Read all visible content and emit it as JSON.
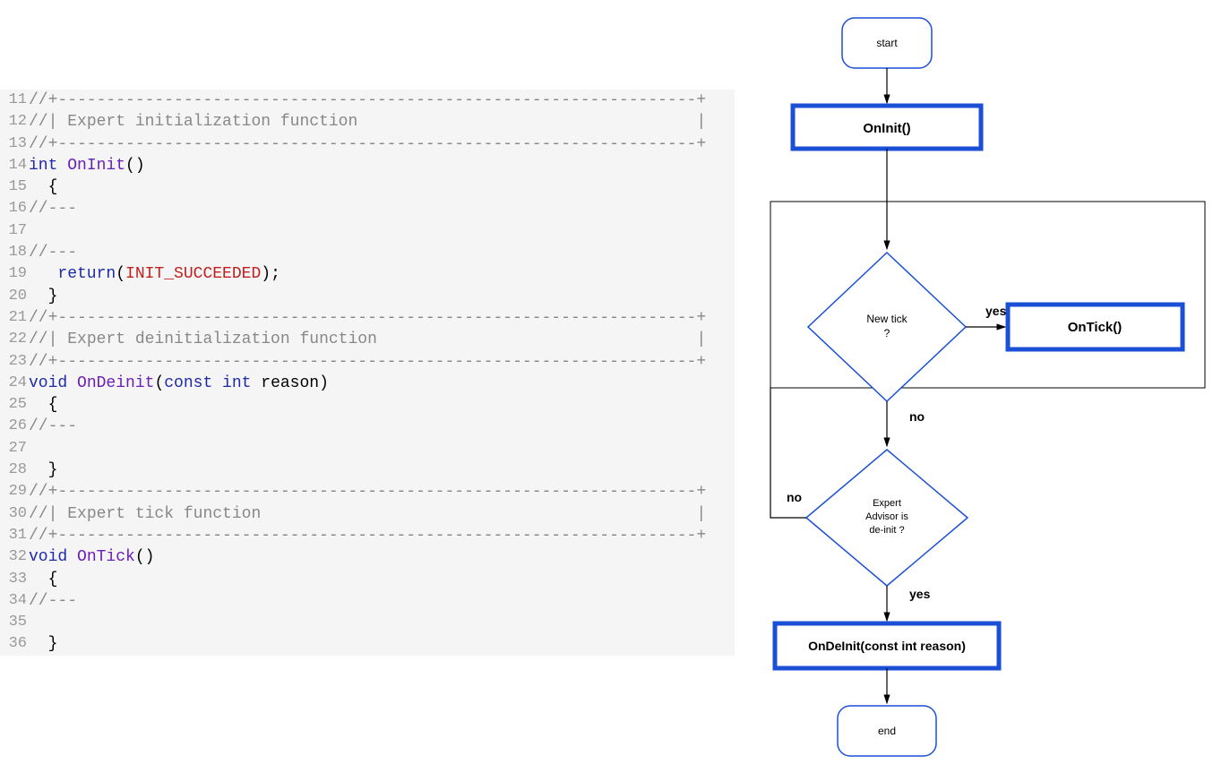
{
  "code": {
    "lines": [
      {
        "num": "11",
        "tokens": [
          {
            "t": "//+",
            "c": "c-gray"
          },
          {
            "t": "------------------------------------------------------------------+",
            "c": "c-gray"
          }
        ]
      },
      {
        "num": "12",
        "tokens": [
          {
            "t": "//| ",
            "c": "c-gray"
          },
          {
            "t": "Expert initialization function",
            "c": "c-gray"
          },
          {
            "t": "                                   |",
            "c": "c-gray"
          }
        ]
      },
      {
        "num": "13",
        "tokens": [
          {
            "t": "//+",
            "c": "c-gray"
          },
          {
            "t": "------------------------------------------------------------------+",
            "c": "c-gray"
          }
        ]
      },
      {
        "num": "14",
        "tokens": [
          {
            "t": "int ",
            "c": "c-kw"
          },
          {
            "t": "OnInit",
            "c": "c-fn"
          },
          {
            "t": "()",
            "c": "c-paren"
          }
        ]
      },
      {
        "num": "15",
        "tokens": [
          {
            "t": "  {",
            "c": "c-id"
          }
        ]
      },
      {
        "num": "16",
        "tokens": [
          {
            "t": "//---",
            "c": "c-gray"
          }
        ]
      },
      {
        "num": "17",
        "tokens": [
          {
            "t": "",
            "c": "c-id"
          }
        ]
      },
      {
        "num": "18",
        "tokens": [
          {
            "t": "//---",
            "c": "c-gray"
          }
        ]
      },
      {
        "num": "19",
        "tokens": [
          {
            "t": "   ",
            "c": "c-id"
          },
          {
            "t": "return",
            "c": "c-kw"
          },
          {
            "t": "(",
            "c": "c-paren"
          },
          {
            "t": "INIT_SUCCEEDED",
            "c": "c-const"
          },
          {
            "t": ");",
            "c": "c-paren"
          }
        ]
      },
      {
        "num": "20",
        "tokens": [
          {
            "t": "  }",
            "c": "c-id"
          }
        ]
      },
      {
        "num": "21",
        "tokens": [
          {
            "t": "//+",
            "c": "c-gray"
          },
          {
            "t": "------------------------------------------------------------------+",
            "c": "c-gray"
          }
        ]
      },
      {
        "num": "22",
        "tokens": [
          {
            "t": "//| ",
            "c": "c-gray"
          },
          {
            "t": "Expert deinitialization function",
            "c": "c-gray"
          },
          {
            "t": "                                 |",
            "c": "c-gray"
          }
        ]
      },
      {
        "num": "23",
        "tokens": [
          {
            "t": "//+",
            "c": "c-gray"
          },
          {
            "t": "------------------------------------------------------------------+",
            "c": "c-gray"
          }
        ]
      },
      {
        "num": "24",
        "tokens": [
          {
            "t": "void ",
            "c": "c-kw"
          },
          {
            "t": "OnDeinit",
            "c": "c-fn"
          },
          {
            "t": "(",
            "c": "c-paren"
          },
          {
            "t": "const int ",
            "c": "c-kw"
          },
          {
            "t": "reason",
            "c": "c-id"
          },
          {
            "t": ")",
            "c": "c-paren"
          }
        ]
      },
      {
        "num": "25",
        "tokens": [
          {
            "t": "  {",
            "c": "c-id"
          }
        ]
      },
      {
        "num": "26",
        "tokens": [
          {
            "t": "//---",
            "c": "c-gray"
          }
        ]
      },
      {
        "num": "27",
        "tokens": [
          {
            "t": "",
            "c": "c-id"
          }
        ]
      },
      {
        "num": "28",
        "tokens": [
          {
            "t": "  }",
            "c": "c-id"
          }
        ]
      },
      {
        "num": "29",
        "tokens": [
          {
            "t": "//+",
            "c": "c-gray"
          },
          {
            "t": "------------------------------------------------------------------+",
            "c": "c-gray"
          }
        ]
      },
      {
        "num": "30",
        "tokens": [
          {
            "t": "//| ",
            "c": "c-gray"
          },
          {
            "t": "Expert tick function",
            "c": "c-gray"
          },
          {
            "t": "                                             |",
            "c": "c-gray"
          }
        ]
      },
      {
        "num": "31",
        "tokens": [
          {
            "t": "//+",
            "c": "c-gray"
          },
          {
            "t": "------------------------------------------------------------------+",
            "c": "c-gray"
          }
        ]
      },
      {
        "num": "32",
        "tokens": [
          {
            "t": "void ",
            "c": "c-kw"
          },
          {
            "t": "OnTick",
            "c": "c-fn"
          },
          {
            "t": "()",
            "c": "c-paren"
          }
        ]
      },
      {
        "num": "33",
        "tokens": [
          {
            "t": "  {",
            "c": "c-id"
          }
        ]
      },
      {
        "num": "34",
        "tokens": [
          {
            "t": "//---",
            "c": "c-gray"
          }
        ]
      },
      {
        "num": "35",
        "tokens": [
          {
            "t": "",
            "c": "c-id"
          }
        ]
      },
      {
        "num": "36",
        "tokens": [
          {
            "t": "  }",
            "c": "c-id"
          }
        ]
      }
    ]
  },
  "flow": {
    "start": "start",
    "oninit": "OnInit()",
    "decision1_l1": "New tick",
    "decision1_l2": "?",
    "ontick": "OnTick()",
    "decision2_l1": "Expert",
    "decision2_l2": "Advisor is",
    "decision2_l3": "de-init ?",
    "ondeinit": "OnDeInit(const int reason)",
    "end": "end",
    "yes": "yes",
    "no": "no"
  }
}
